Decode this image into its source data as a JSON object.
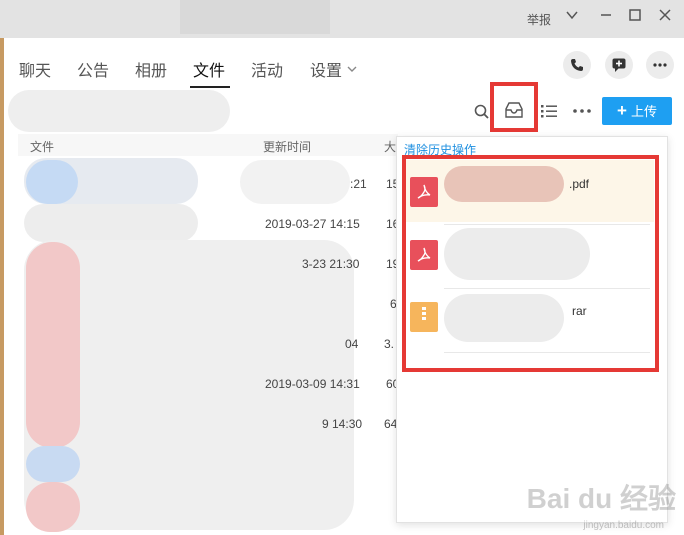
{
  "titlebar": {
    "report_label": "举报"
  },
  "tabs": [
    {
      "label": "聊天"
    },
    {
      "label": "公告"
    },
    {
      "label": "相册"
    },
    {
      "label": "文件"
    },
    {
      "label": "活动"
    },
    {
      "label": "设置"
    }
  ],
  "active_tab": "文件",
  "toolbar": {
    "upload_label": "上传",
    "upload_plus": "+"
  },
  "table": {
    "headers": {
      "file": "文件",
      "updated": "更新时间",
      "size_partial": "大"
    },
    "rows": [
      {
        "date": ":21",
        "size": "15"
      },
      {
        "date": "2019-03-27 14:15",
        "size": "16"
      },
      {
        "date": "3-23 21:30",
        "size": "19"
      },
      {
        "date": "",
        "size": "6"
      },
      {
        "date": "04",
        "size": "3."
      },
      {
        "date": "2019-03-09 14:31",
        "size": "60"
      },
      {
        "date": "9 14:30",
        "size": "64"
      }
    ]
  },
  "history_panel": {
    "clear_label": "清除历史操作",
    "items": [
      {
        "name_suffix": ".pdf",
        "icon": "pdf-icon"
      },
      {
        "name_suffix": "",
        "icon": "pdf-icon"
      },
      {
        "name_suffix": "rar",
        "icon": "zip-icon"
      }
    ]
  },
  "watermark": {
    "brand": "Bai du 经验",
    "url": "jingyan.baidu.com"
  },
  "colors": {
    "accent": "#1e9ff2",
    "highlight": "#e53935",
    "pdf": "#e8505b",
    "zip": "#f6b55c"
  }
}
